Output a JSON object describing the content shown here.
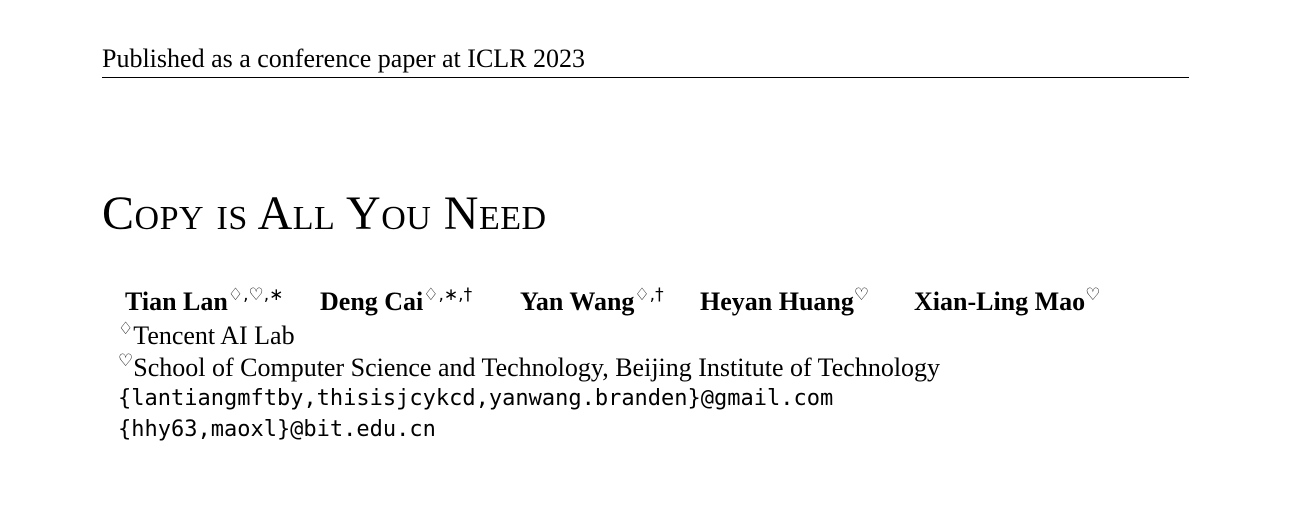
{
  "header": {
    "text": "Published as a conference paper at ICLR 2023"
  },
  "title": "Copy is All You Need",
  "authors": [
    {
      "name": "Tian Lan",
      "marks": "♢,♡,∗"
    },
    {
      "name": "Deng Cai",
      "marks": "♢,∗,†"
    },
    {
      "name": "Yan Wang",
      "marks": "♢,†"
    },
    {
      "name": "Heyan Huang",
      "marks": "♡"
    },
    {
      "name": "Xian-Ling Mao",
      "marks": "♡"
    }
  ],
  "affiliations": [
    {
      "symbol": "♢",
      "text": "Tencent AI Lab"
    },
    {
      "symbol": "♡",
      "text": "School of Computer Science and Technology, Beijing Institute of Technology"
    }
  ],
  "emails": [
    "{lantiangmftby,thisisjcykcd,yanwang.branden}@gmail.com",
    "{hhy63,maoxl}@bit.edu.cn"
  ]
}
